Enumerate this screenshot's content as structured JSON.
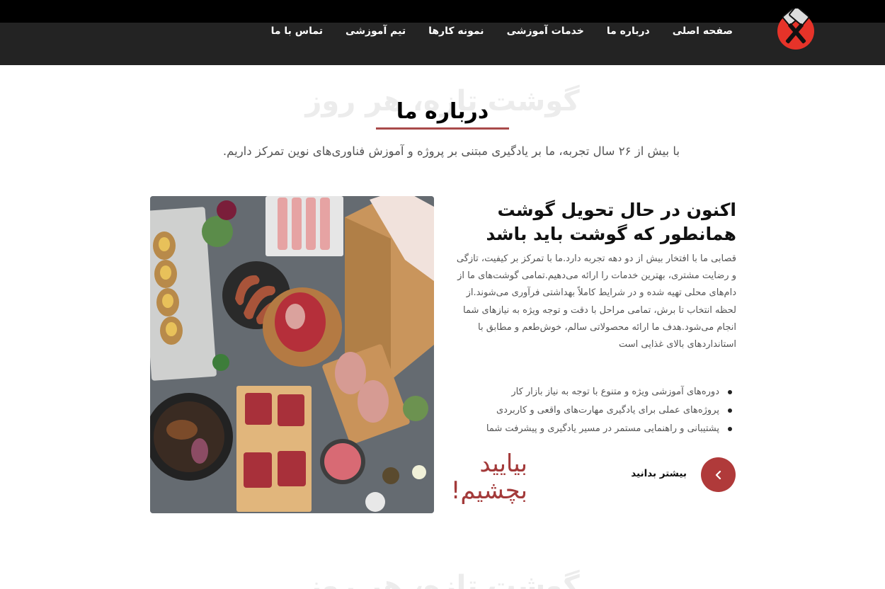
{
  "nav": {
    "items": [
      {
        "label": "صفحه اصلی"
      },
      {
        "label": "درباره ما"
      },
      {
        "label": "خدمات آموزشی"
      },
      {
        "label": "نمونه کارها"
      },
      {
        "label": "تیم آموزشی"
      },
      {
        "label": "تماس با ما"
      }
    ]
  },
  "logo": {
    "icon": "crossed-cleavers-icon",
    "color": "#e63329"
  },
  "about": {
    "ghost_text": "گوشت تازه، هر روز",
    "title": "درباره ما",
    "subtitle": "با بیش از ۲۶ سال تجربه، ما بر یادگیری مبتنی بر پروژه و آموزش فناوری‌های نوین تمرکز داریم.",
    "image_alt": "meat-delivery-photo",
    "heading_line1": "اکنون در حال تحویل گوشت",
    "heading_line2": "همانطور که گوشت باید باشد",
    "paragraph": "قصابی ما با افتخار بیش از دو دهه تجربه دارد.ما با تمرکز بر کیفیت، تازگی و رضایت مشتری، بهترین خدمات را ارائه می‌دهیم.تمامی گوشت‌های ما از دام‌های محلی تهیه شده و در شرایط کاملاً بهداشتی فرآوری می‌شوند.از لحظه انتخاب تا برش، تمامی مراحل با دقت و توجه ویژه به نیازهای شما انجام می‌شود.هدف ما ارائه محصولاتی سالم، خوش‌طعم و مطابق با استانداردهای بالای غذایی است",
    "bullets": [
      {
        "text": "دوره‌های آموزشی ویژه و متنوع با توجه به نیاز بازار کار"
      },
      {
        "text": "پروژه‌های عملی برای یادگیری مهارت‌های واقعی و کاربردی"
      },
      {
        "text": "پشتیبانی و راهنمایی مستمر در مسیر یادگیری و پیشرفت شما"
      }
    ],
    "come_line1": "بیایید",
    "come_line2": "بچشیم!",
    "learn_more": "بیشتر بدانید",
    "accent": "#b03a3a"
  },
  "next_section": {
    "ghost_text": "گوشت تازه، هر روز"
  }
}
